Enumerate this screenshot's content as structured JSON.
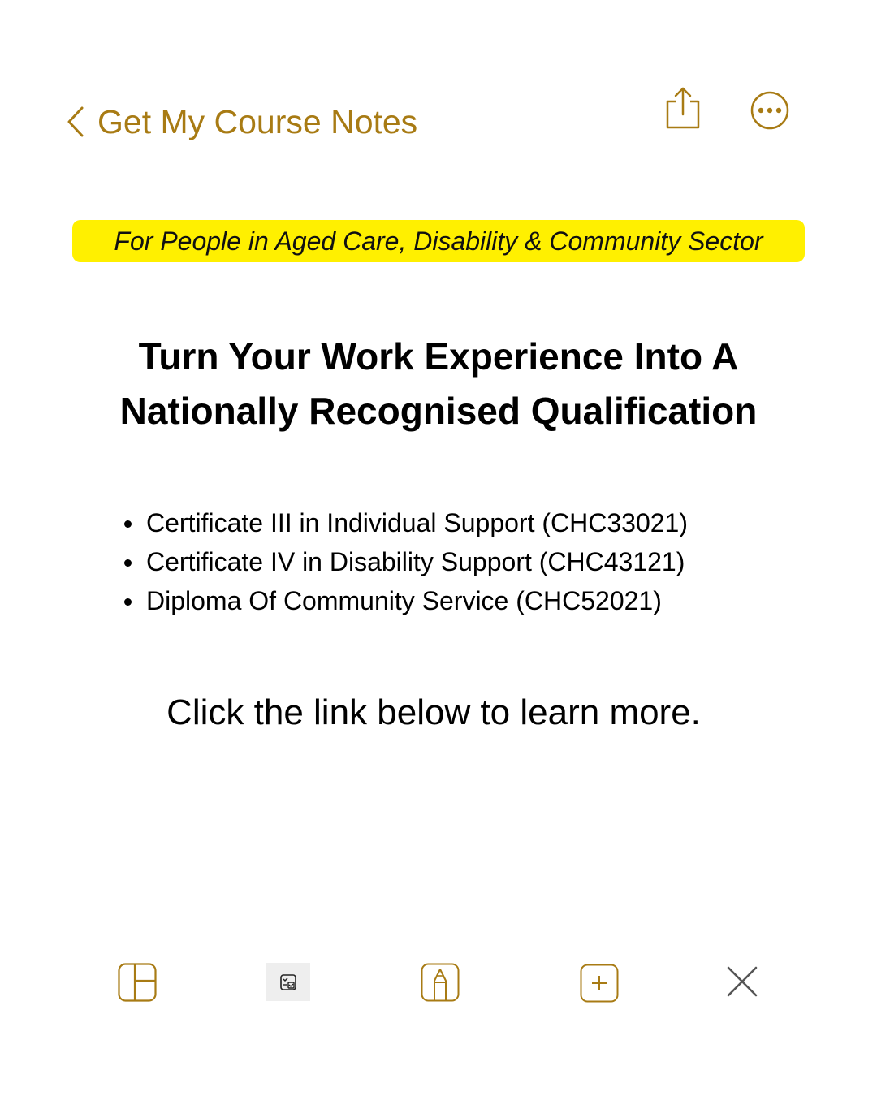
{
  "nav": {
    "back_label": "Get My Course Notes",
    "accent_color": "#a87b14",
    "icons": [
      "chevron-left-icon",
      "share-icon",
      "more-icon"
    ]
  },
  "banner": {
    "text": "For People in Aged Care, Disability & Community Sector",
    "color": "#fff000"
  },
  "headline": {
    "line1": "Turn Your Work Experience Into A",
    "line2": "Nationally Recognised Qualification"
  },
  "courses": [
    "Certificate III in Individual Support (CHC33021)",
    "Certificate IV in Disability Support (CHC43121)",
    "Diploma Of Community Service (CHC52021)"
  ],
  "cta": {
    "text": "Click the link below to learn more."
  },
  "toolbar": {
    "icons": [
      "layout-icon",
      "checklist-icon",
      "markup-pen-icon",
      "add-icon",
      "close-icon"
    ]
  }
}
